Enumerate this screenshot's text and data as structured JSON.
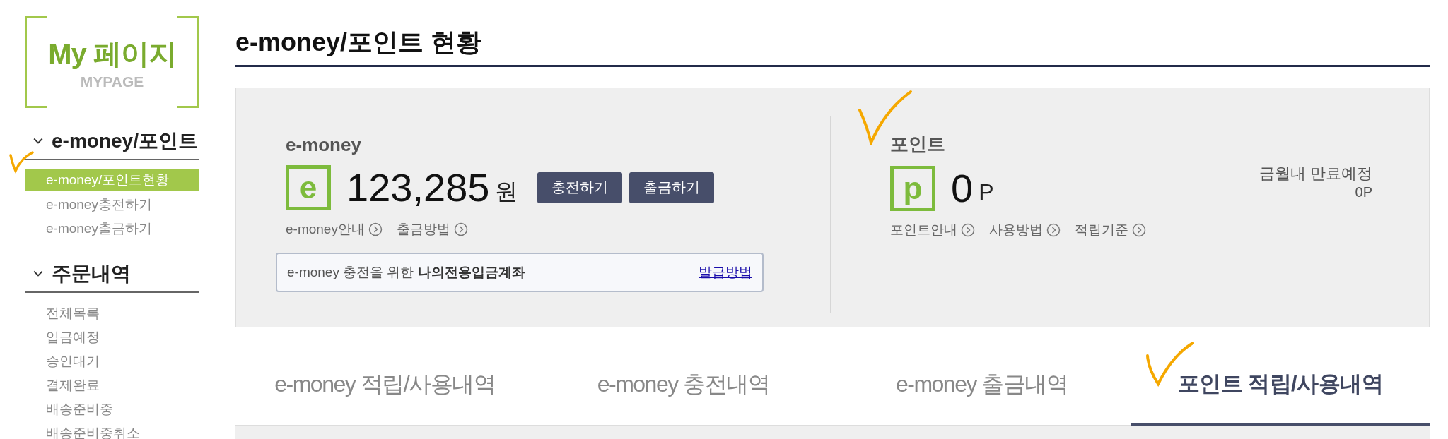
{
  "logo": {
    "title": "My 페이지",
    "subtitle": "MYPAGE"
  },
  "sidebar": {
    "sections": [
      {
        "title": "e-money/포인트",
        "expanded": true,
        "items": [
          {
            "label": "e-money/포인트현황",
            "selected": true
          },
          {
            "label": "e-money충전하기",
            "selected": false
          },
          {
            "label": "e-money출금하기",
            "selected": false
          }
        ]
      },
      {
        "title": "주문내역",
        "expanded": true,
        "items": [
          {
            "label": "전체목록",
            "selected": false
          },
          {
            "label": "입금예정",
            "selected": false
          },
          {
            "label": "승인대기",
            "selected": false
          },
          {
            "label": "결제완료",
            "selected": false
          },
          {
            "label": "배송준비중",
            "selected": false
          },
          {
            "label": "배송준비중취소",
            "selected": false
          }
        ]
      }
    ]
  },
  "page_title": "e-money/포인트 현황",
  "emoney": {
    "title": "e-money",
    "badge": "e",
    "amount": "123,285",
    "unit": "원",
    "buttons": [
      "충전하기",
      "출금하기"
    ],
    "links": [
      "e-money안내",
      "출금방법"
    ],
    "account_notice": {
      "text": "e-money 충전을 위한 **나의전용입금계좌**",
      "link": "발급방법"
    }
  },
  "points": {
    "title": "포인트",
    "badge": "p",
    "amount": "0",
    "unit": "P",
    "links": [
      "포인트안내",
      "사용방법",
      "적립기준"
    ],
    "expiry_label": "금월내 만료예정",
    "expiry_value": "0P"
  },
  "tabs": [
    {
      "label": "e-money 적립/사용내역",
      "selected": false
    },
    {
      "label": "e-money 충전내역",
      "selected": false
    },
    {
      "label": "e-money 출금내역",
      "selected": false
    },
    {
      "label": "포인트 적립/사용내역",
      "selected": true
    }
  ]
}
